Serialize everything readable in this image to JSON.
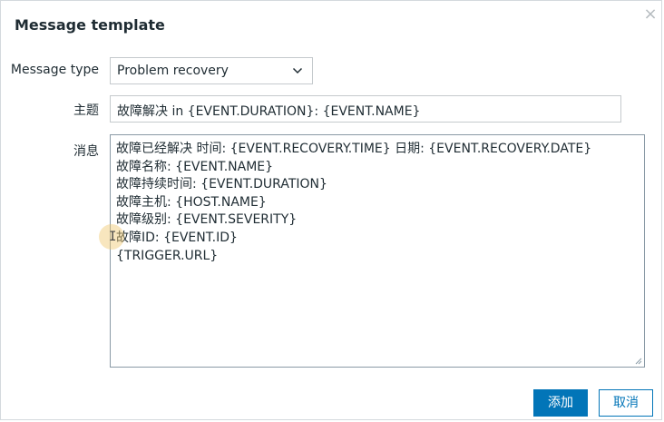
{
  "dialog": {
    "title": "Message template",
    "close_glyph": "×"
  },
  "form": {
    "message_type_label": "Message type",
    "message_type_value": "Problem recovery",
    "subject_label": "主题",
    "subject_value": "故障解决 in {EVENT.DURATION}: {EVENT.NAME}",
    "message_label": "消息",
    "message_lines": [
      "故障已经解决  时间: {EVENT.RECOVERY.TIME} 日期: {EVENT.RECOVERY.DATE}",
      "故障名称: {EVENT.NAME}",
      "故障持续时间: {EVENT.DURATION}",
      "故障主机: {HOST.NAME}",
      "故障级别: {EVENT.SEVERITY}",
      "故障ID: {EVENT.ID}",
      "{TRIGGER.URL}"
    ]
  },
  "buttons": {
    "add_label": "添加",
    "cancel_label": "取消"
  },
  "icons": {
    "close": "close-icon",
    "chevron": "chevron-down-icon",
    "resize": "resize-grip-icon",
    "text_cursor": "text-cursor-icon"
  },
  "colors": {
    "primary": "#0275b8",
    "text": "#1f2c33",
    "border": "#c5cacd"
  }
}
